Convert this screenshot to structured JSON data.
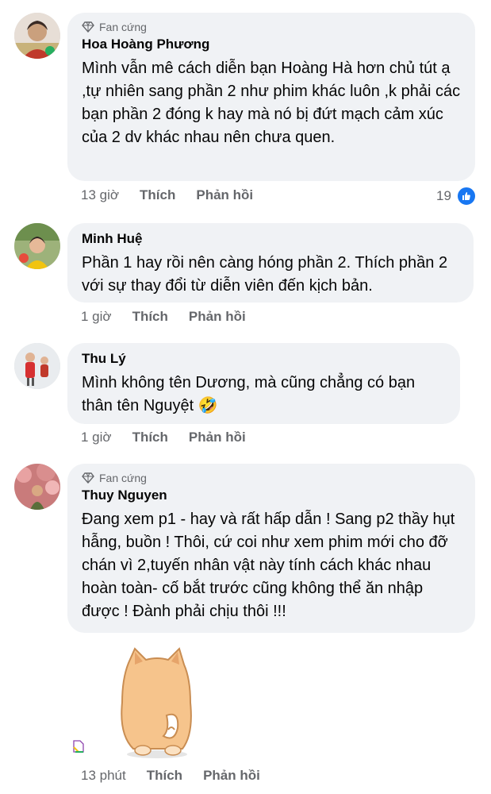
{
  "comments": [
    {
      "badge": "Fan cứng",
      "name": "Hoa Hoàng Phương",
      "text": "Mình vẫn mê cách diễn bạn Hoàng Hà hơn chủ tút ạ ,tự nhiên sang phần 2 như phim khác luôn ,k phải các bạn phần 2 đóng k hay mà nó bị đứt mạch cảm xúc của 2 dv khác nhau nên chưa quen.",
      "time": "13 giờ",
      "like": "Thích",
      "reply": "Phản hồi",
      "reaction_count": "19"
    },
    {
      "name": "Minh Huệ",
      "text": "Phần 1 hay rồi nên càng hóng phần 2. Thích phần 2 với sự thay đổi từ diễn viên đến kịch bản.",
      "time": "1 giờ",
      "like": "Thích",
      "reply": "Phản hồi"
    },
    {
      "name": "Thu Lý",
      "text": "Mình không tên Dương, mà cũng chẳng có bạn thân tên Nguyệt",
      "emoji": "🤣",
      "time": "1 giờ",
      "like": "Thích",
      "reply": "Phản hồi"
    },
    {
      "badge": "Fan cứng",
      "name": "Thuy Nguyen",
      "text": "Đang xem p1 - hay và rất hấp dẫn ! Sang p2 thầy hụt hẫng, buồn ! Thôi, cứ coi như xem phim mới cho đỡ chán vì 2,tuyến nhân vật này tính cách khác nhau hoàn toàn- cố bắt trước cũng không thể ăn nhập được ! Đành phải chịu thôi !!!",
      "time": "13 phút",
      "like": "Thích",
      "reply": "Phản hồi"
    }
  ],
  "icons": {
    "badge": "diamond-icon",
    "reaction": "like-thumb-icon",
    "sticker": "shiba-dog-sticker",
    "sticker_tag": "sticker-file-icon"
  },
  "colors": {
    "bubble": "#f0f2f5",
    "meta": "#65676b",
    "like": "#1877f2"
  }
}
